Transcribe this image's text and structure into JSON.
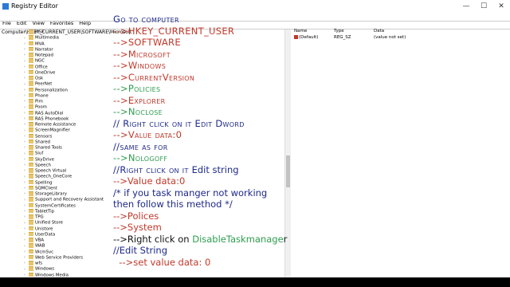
{
  "window": {
    "title": "Registry Editor",
    "controls": {
      "minimize": "—",
      "maximize": "☐",
      "close": "✕"
    }
  },
  "menu": [
    "File",
    "Edit",
    "View",
    "Favorites",
    "Help"
  ],
  "address": "Computer\\HKEY_CURRENT_USER\\SOFTWARE\\Microsoft",
  "tree": [
    "MSF",
    "Multimedia",
    "MVA",
    "Narrator",
    "Notepad",
    "NGC",
    "Office",
    "OneDrive",
    "Osk",
    "PeerNet",
    "Personalization",
    "Phone",
    "Pim",
    "Poom",
    "RAS AutoDial",
    "RAS Phonebook",
    "Remote Assistance",
    "ScreenMagnifier",
    "Sensors",
    "Shared",
    "Shared Tools",
    "Siuf",
    "SkyDrive",
    "Speech",
    "Speech Virtual",
    "Speech_OneCore",
    "Spelling",
    "SQMClient",
    "StorageLibrary",
    "Support and Recovery Assistant",
    "SystemCertificates",
    "TabletTip",
    "TPG",
    "Unified Store",
    "Unistore",
    "UserData",
    "VBA",
    "WAB",
    "WcmSvc",
    "Web Service Providers",
    "wfs",
    "Windows",
    "Windows Media"
  ],
  "values_panel": {
    "headers": {
      "name": "Name",
      "type": "Type",
      "data": "Data"
    },
    "rows": [
      {
        "name": "(Default)",
        "type": "REG_SZ",
        "data": "(value not set)"
      }
    ]
  },
  "overlay": [
    {
      "text": "Go to computer",
      "color": "navy",
      "smallcaps": true
    },
    {
      "text": "-->HKEY_CURRENT_USER",
      "color": "red",
      "smallcaps": true
    },
    {
      "text": "-->SOFTWARE",
      "color": "red",
      "smallcaps": true
    },
    {
      "text": "-->Microsoft",
      "color": "red",
      "smallcaps": true
    },
    {
      "text": "-->Windows",
      "color": "red",
      "smallcaps": true
    },
    {
      "text": "-->CurrentVersion",
      "color": "red",
      "smallcaps": true
    },
    {
      "text": "-->Policies",
      "color": "green",
      "smallcaps": true
    },
    {
      "text": "-->Explorer",
      "color": "red",
      "smallcaps": true
    },
    {
      "text": "-->Noclose",
      "color": "green",
      "smallcaps": true
    },
    {
      "text": "// Right click on it Edit Dword",
      "color": "navy",
      "smallcaps": true
    },
    {
      "text": "-->Value data:0",
      "color": "red",
      "smallcaps": true
    },
    {
      "text": "//same as for",
      "color": "navy",
      "smallcaps": true
    },
    {
      "text": "-->Nologoff",
      "color": "green",
      "smallcaps": true
    },
    {
      "parts": [
        {
          "text": "//Right click on it ",
          "color": "navy",
          "smallcaps": true
        },
        {
          "text": "Edit string",
          "color": "navy",
          "smallcaps": false
        }
      ]
    },
    {
      "text": "-->Value data:0",
      "color": "red",
      "smallcaps": false
    },
    {
      "text": "/* if you task manger not working",
      "color": "navy",
      "smallcaps": false
    },
    {
      "text": "then follow this method */",
      "color": "navy",
      "smallcaps": false
    },
    {
      "text": "-->Polices",
      "color": "red",
      "smallcaps": false
    },
    {
      "text": "-->System",
      "color": "red",
      "smallcaps": false
    },
    {
      "parts": [
        {
          "text": "-->Right click on ",
          "color": "black",
          "smallcaps": false
        },
        {
          "text": "DisableTaskmanage",
          "color": "green",
          "smallcaps": false
        },
        {
          "text": "r",
          "color": "black",
          "smallcaps": false
        }
      ]
    },
    {
      "text": "//Edit String",
      "color": "navy",
      "smallcaps": false
    },
    {
      "text": "  -->set value data: 0",
      "color": "red",
      "smallcaps": false
    }
  ]
}
